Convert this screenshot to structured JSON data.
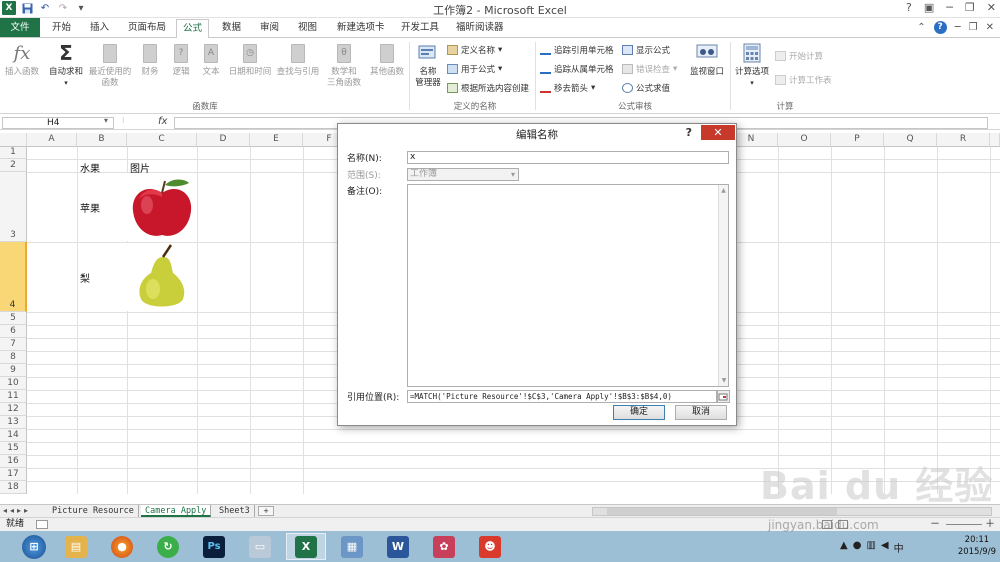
{
  "window": {
    "title": "工作簿2 - Microsoft Excel"
  },
  "tabs": [
    "文件",
    "开始",
    "插入",
    "页面布局",
    "公式",
    "数据",
    "审阅",
    "视图",
    "新建选项卡",
    "开发工具",
    "福昕阅读器"
  ],
  "active_tab": "公式",
  "ribbon": {
    "func_lib": {
      "insert_fn": "插入函数",
      "autosum": "自动求和",
      "recent": "最近使用的\n函数",
      "finance": "财务",
      "logical": "逻辑",
      "text": "文本",
      "datetime": "日期和时间",
      "lookup": "查找与引用",
      "math": "数学和\n三角函数",
      "other": "其他函数",
      "group": "函数库"
    },
    "names": {
      "manager": "名称\n管理器",
      "define": "定义名称",
      "use_in": "用于公式",
      "create": "根据所选内容创建",
      "group": "定义的名称"
    },
    "audit": {
      "trace_prec": "追踪引用单元格",
      "trace_dep": "追踪从属单元格",
      "remove": "移去箭头",
      "show": "显示公式",
      "errcheck": "错误检查",
      "eval": "公式求值",
      "watch": "监视窗口",
      "group": "公式审核"
    },
    "calc": {
      "options": "计算选项",
      "calc_now": "开始计算",
      "calc_sheet": "计算工作表",
      "group": "计算"
    }
  },
  "formula_bar": {
    "name_box": "H4",
    "fx": "fx"
  },
  "columns": [
    "A",
    "B",
    "C",
    "D",
    "E",
    "F",
    "",
    "",
    "",
    "",
    "",
    "",
    "",
    "N",
    "O",
    "P",
    "Q",
    "R"
  ],
  "rows": [
    "1",
    "2",
    "3",
    "4",
    "5",
    "6",
    "7",
    "8",
    "9",
    "10",
    "11",
    "12",
    "13",
    "14",
    "15",
    "16",
    "17",
    "18"
  ],
  "cells": {
    "b2": "水果",
    "c2": "图片",
    "b3": "苹果",
    "b4": "梨"
  },
  "pictures": {
    "apple": "apple-photo",
    "pear": "pear-photo"
  },
  "sheets": [
    "Picture Resource",
    "Camera Apply",
    "Sheet3"
  ],
  "active_sheet": "Camera Apply",
  "status": {
    "ready": "就绪"
  },
  "dialog": {
    "title": "编辑名称",
    "help": "?",
    "name_label": "名称(N):",
    "name_value": "x",
    "scope_label": "范围(S):",
    "scope_value": "工作簿",
    "comment_label": "备注(O):",
    "refers_label": "引用位置(R):",
    "refers_value": "=MATCH('Picture Resource'!$C$3,'Camera Apply'!$B$3:$B$4,0)",
    "ok": "确定",
    "cancel": "取消"
  },
  "taskbar": {
    "time": "20:11",
    "date": "2015/9/9"
  },
  "watermark": {
    "brand": "Bai du 经验",
    "url": "jingyan.baidu.com"
  },
  "colors": {
    "excel_green": "#1f7346",
    "close_red": "#c7392a",
    "selected_row": "#f9d776"
  }
}
